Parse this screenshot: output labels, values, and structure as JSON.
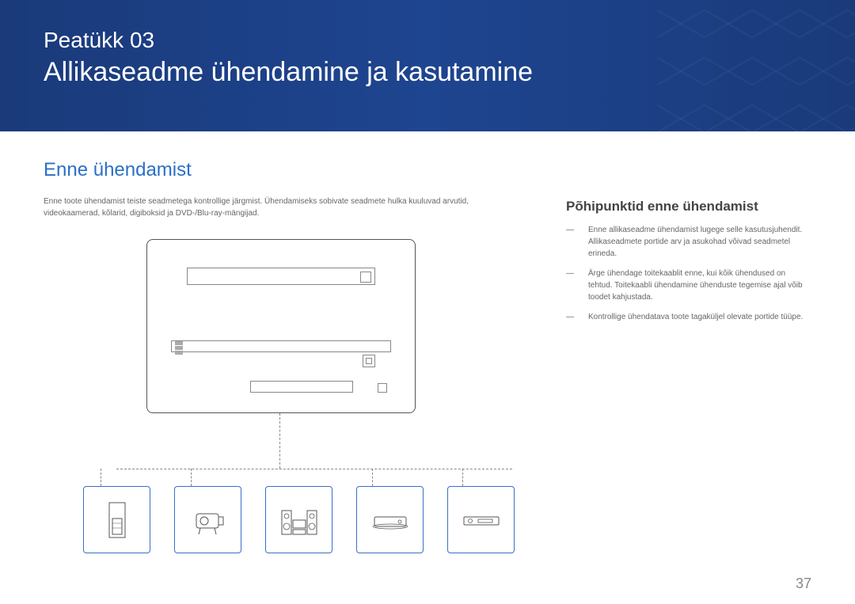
{
  "header": {
    "chapter_label": "Peatükk 03",
    "chapter_title": "Allikaseadme ühendamine ja kasutamine"
  },
  "main": {
    "section_title": "Enne ühendamist",
    "intro_text": "Enne toote ühendamist teiste seadmetega kontrollige järgmist. Ühendamiseks sobivate seadmete hulka kuuluvad arvutid, videokaamerad, kõlarid, digiboksid ja DVD-/Blu-ray-mängijad."
  },
  "sidebar": {
    "subsection_title": "Põhipunktid enne ühendamist",
    "points": [
      "Enne allikaseadme ühendamist lugege selle kasutusjuhendit. Allikaseadmete portide arv ja asukohad võivad seadmetel erineda.",
      "Ärge ühendage toitekaablit enne, kui kõik ühendused on tehtud. Toitekaabli ühendamine ühenduste tegemise ajal võib toodet kahjustada.",
      "Kontrollige ühendatava toote tagaküljel olevate portide tüüpe."
    ]
  },
  "page_number": "37"
}
